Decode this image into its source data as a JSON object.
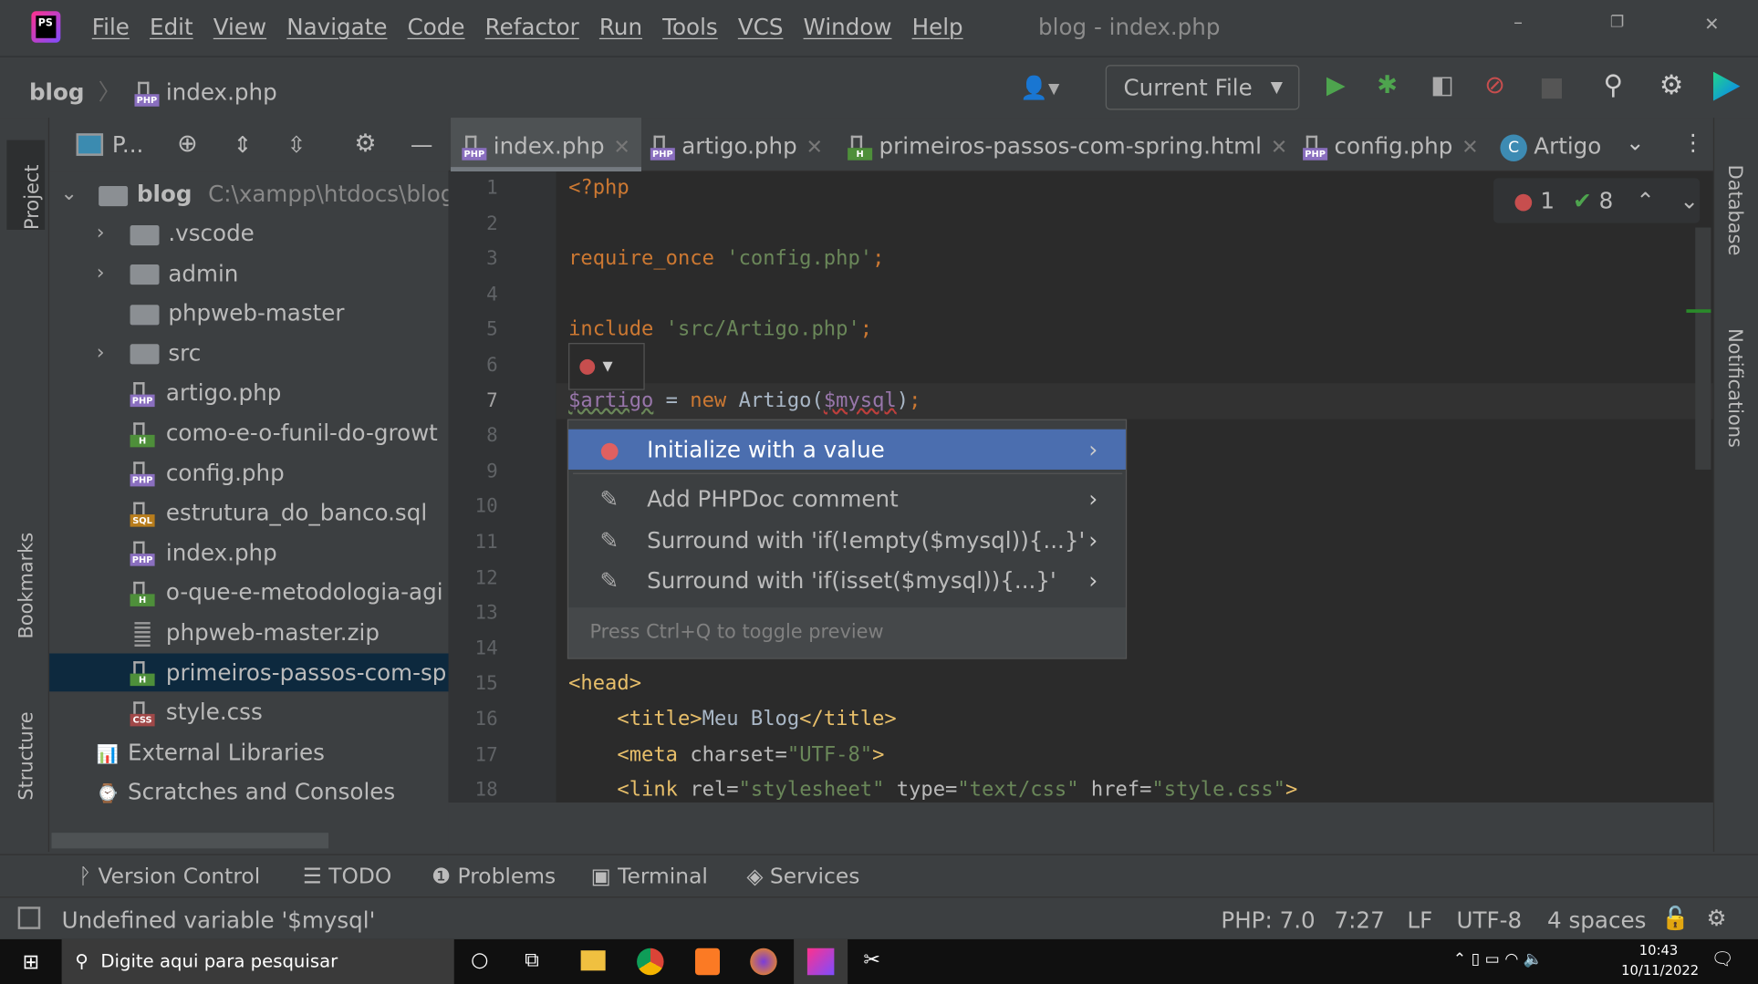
{
  "titlebar": {
    "menu": [
      "File",
      "Edit",
      "View",
      "Navigate",
      "Code",
      "Refactor",
      "Run",
      "Tools",
      "VCS",
      "Window",
      "Help"
    ],
    "title": "blog - index.php"
  },
  "navbar": {
    "breadcrumb": [
      "blog",
      "index.php"
    ],
    "run_config": "Current File"
  },
  "project": {
    "header": "P...",
    "root": {
      "name": "blog",
      "path": "C:\\xampp\\htdocs\\blog"
    },
    "items": [
      {
        "name": ".vscode",
        "type": "folder"
      },
      {
        "name": "admin",
        "type": "folder"
      },
      {
        "name": "phpweb-master",
        "type": "folder"
      },
      {
        "name": "src",
        "type": "folder"
      },
      {
        "name": "artigo.php",
        "type": "php"
      },
      {
        "name": "como-e-o-funil-do-growt",
        "type": "html"
      },
      {
        "name": "config.php",
        "type": "php"
      },
      {
        "name": "estrutura_do_banco.sql",
        "type": "sql"
      },
      {
        "name": "index.php",
        "type": "php"
      },
      {
        "name": "o-que-e-metodologia-agi",
        "type": "html"
      },
      {
        "name": "phpweb-master.zip",
        "type": "zip"
      },
      {
        "name": "primeiros-passos-com-spr",
        "type": "html"
      },
      {
        "name": "style.css",
        "type": "css"
      }
    ],
    "external": "External Libraries",
    "scratches": "Scratches and Consoles"
  },
  "tabs": [
    "index.php",
    "artigo.php",
    "primeiros-passos-com-spring.html",
    "config.php",
    "Artigo"
  ],
  "inspections": {
    "errors": "1",
    "ok": "8"
  },
  "popup": {
    "items": [
      "Initialize with a value",
      "Add PHPDoc comment",
      "Surround with 'if(!empty($mysql)){...}'",
      "Surround with 'if(isset($mysql)){...}'"
    ],
    "hint": "Press Ctrl+Q to toggle preview"
  },
  "side": {
    "left": [
      "Project",
      "Bookmarks",
      "Structure"
    ],
    "right": [
      "Database",
      "Notifications"
    ]
  },
  "toolwindows": [
    "Version Control",
    "TODO",
    "Problems",
    "Terminal",
    "Services"
  ],
  "status": {
    "message": "Undefined variable '$mysql'",
    "php": "PHP: 7.0",
    "pos": "7:27",
    "lf": "LF",
    "enc": "UTF-8",
    "indent": "4 spaces"
  },
  "taskbar": {
    "search": "Digite aqui para pesquisar",
    "time": "10:43",
    "date": "10/11/2022"
  }
}
